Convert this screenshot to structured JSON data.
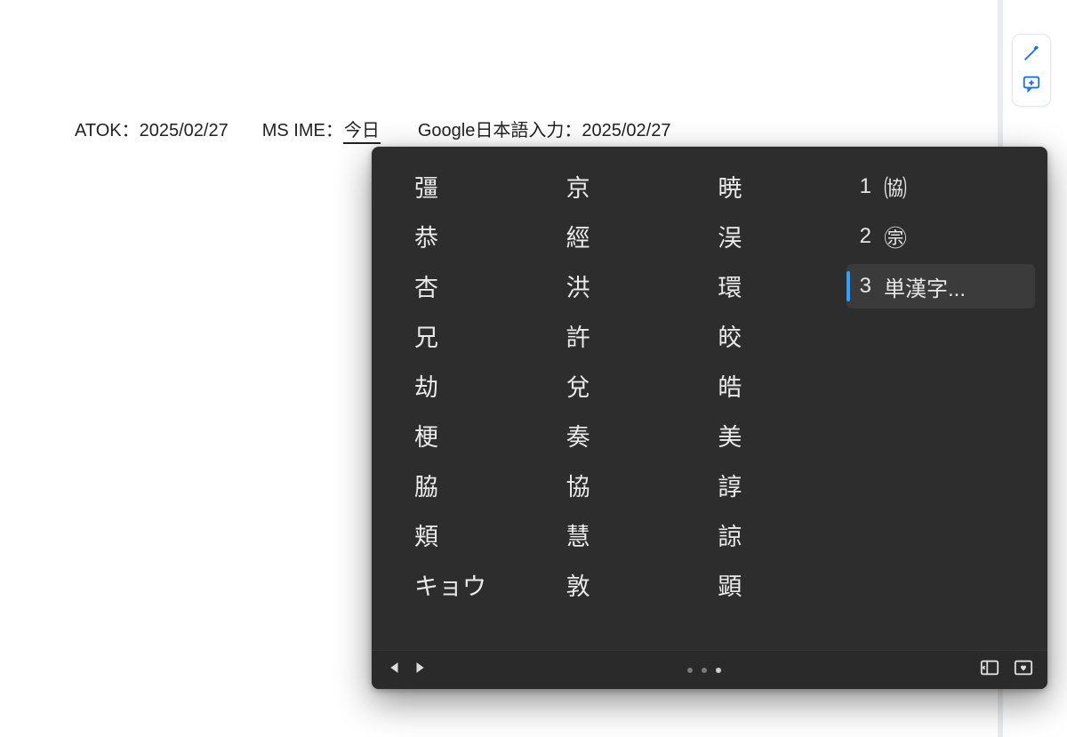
{
  "doc_line": {
    "atok_label": "ATOK：",
    "atok_value": "2025/02/27",
    "msime_label": "MS IME：",
    "msime_current": "今日",
    "google_label": "Google日本語入力：",
    "google_value": "2025/02/27"
  },
  "ime": {
    "columns": [
      [
        "彊",
        "恭",
        "杏",
        "兄",
        "劫",
        "梗",
        "脇",
        "頬",
        "キョウ"
      ],
      [
        "京",
        "經",
        "洪",
        "許",
        "兌",
        "奏",
        "協",
        "慧",
        "敦"
      ],
      [
        "暁",
        "洖",
        "環",
        "皎",
        "皓",
        "美",
        "諄",
        "諒",
        "顕"
      ]
    ],
    "side": [
      {
        "num": "1",
        "label": "㈿",
        "selected": false
      },
      {
        "num": "2",
        "label": "㊪",
        "selected": false
      },
      {
        "num": "3",
        "label": "単漢字...",
        "selected": true
      }
    ],
    "page_dots": {
      "total": 3,
      "active_index": 2
    }
  }
}
